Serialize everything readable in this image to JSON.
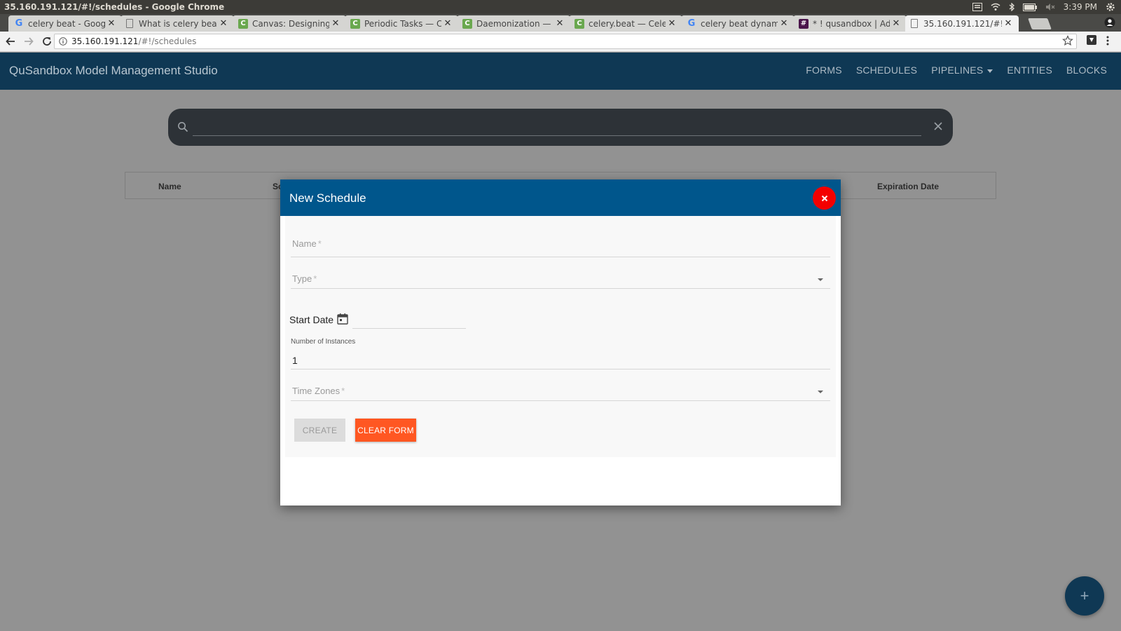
{
  "window": {
    "title": "35.160.191.121/#!/schedules - Google Chrome"
  },
  "tray": {
    "time": "3:39 PM"
  },
  "tabs": [
    {
      "title": "celery beat - Google",
      "favicon": "google-icon"
    },
    {
      "title": "What is celery beat",
      "favicon": "document-icon"
    },
    {
      "title": "Canvas: Designing",
      "favicon": "celery-icon"
    },
    {
      "title": "Periodic Tasks — Ce",
      "favicon": "celery-icon"
    },
    {
      "title": "Daemonization — C",
      "favicon": "celery-icon"
    },
    {
      "title": "celery.beat — Celer",
      "favicon": "celery-icon"
    },
    {
      "title": "celery beat dynami",
      "favicon": "google-icon"
    },
    {
      "title": "* ! qusandbox | Ada",
      "favicon": "slack-icon"
    },
    {
      "title": "35.160.191.121/#!/s",
      "favicon": "document-icon",
      "active": true
    }
  ],
  "address": {
    "host": "35.160.191.121",
    "path": "/#!/schedules"
  },
  "app": {
    "title": "QuSandbox Model Management Studio",
    "nav": [
      "FORMS",
      "SCHEDULES",
      "PIPELINES",
      "ENTITIES",
      "BLOCKS"
    ]
  },
  "table": {
    "col_name": "Name",
    "col_sc": "Sc",
    "col_expiration": "Expiration Date"
  },
  "modal": {
    "title": "New Schedule",
    "name_placeholder": "Name",
    "type_placeholder": "Type",
    "required_mark": "*",
    "start_date_label": "Start Date",
    "instances_label": "Number of Instances",
    "instances_value": "1",
    "timezones_placeholder": "Time Zones",
    "create_label": "CREATE",
    "clear_label": "CLEAR FORM"
  },
  "fab": {
    "label": "+"
  },
  "colors": {
    "header": "#0f3854",
    "modal_header": "#00568c",
    "close": "#f40000",
    "clear_button": "#ff5722"
  }
}
